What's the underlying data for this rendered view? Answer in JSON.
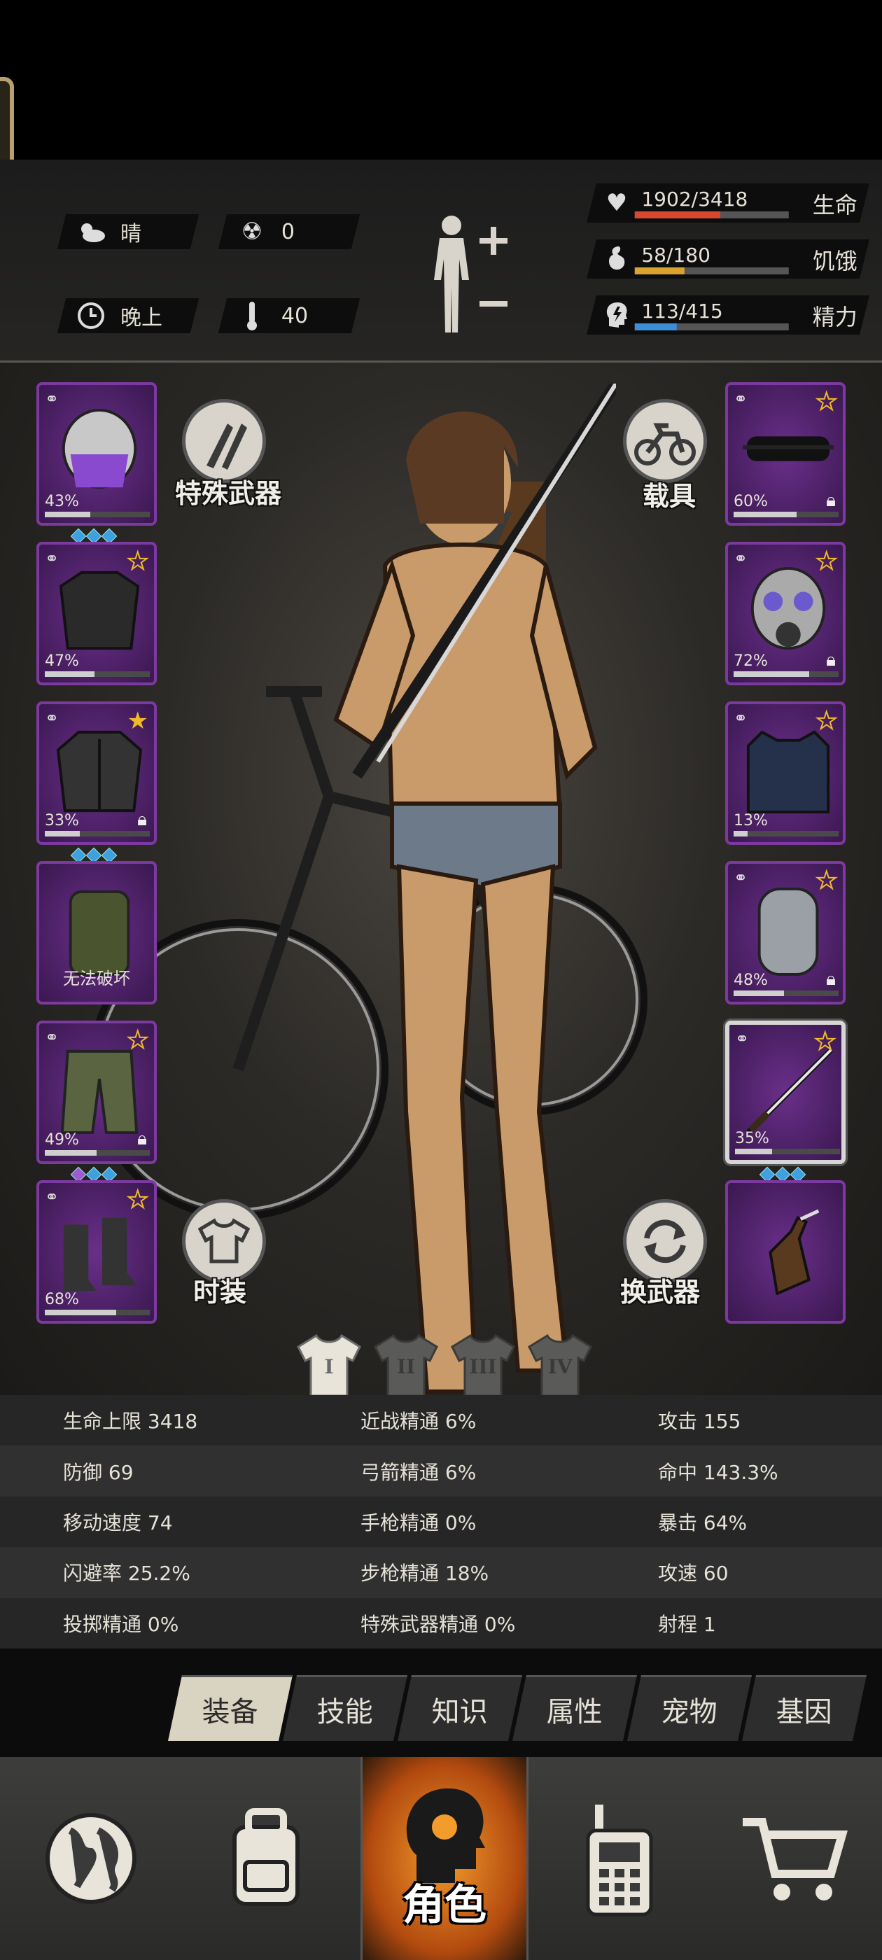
{
  "status": {
    "weather": {
      "icon": "cloud-sun-icon",
      "label": "晴"
    },
    "radiation": {
      "icon": "radiation-icon",
      "value": "0"
    },
    "time": {
      "icon": "clock-icon",
      "label": "晚上"
    },
    "temperature": {
      "icon": "thermometer-icon",
      "value": "40"
    },
    "vitals": [
      {
        "key": "life",
        "icon": "heart-icon",
        "value": "1902/3418",
        "label": "生命",
        "fill": 0.556,
        "color": "#d9482e"
      },
      {
        "key": "hunger",
        "icon": "stomach-icon",
        "value": "58/180",
        "label": "饥饿",
        "fill": 0.322,
        "color": "#d9a32e"
      },
      {
        "key": "energy",
        "icon": "head-bolt-icon",
        "value": "113/415",
        "label": "精力",
        "fill": 0.272,
        "color": "#3c8ed9"
      }
    ]
  },
  "slots_left": [
    {
      "name": "helmet",
      "icon": "police-helmet-icon",
      "pct": "43%",
      "durability": 0.43,
      "gems": 3
    },
    {
      "name": "shirt",
      "icon": "shirt-icon",
      "pct": "47%",
      "durability": 0.47,
      "star": "outline"
    },
    {
      "name": "jacket",
      "icon": "jacket-icon",
      "pct": "33%",
      "durability": 0.33,
      "star": "filled",
      "locked": true,
      "gems": 3
    },
    {
      "name": "backpack",
      "icon": "backpack-icon",
      "text": "无法破坏"
    },
    {
      "name": "pants",
      "icon": "camo-pants-icon",
      "pct": "49%",
      "durability": 0.49,
      "star": "outline",
      "locked": true,
      "gems": 3,
      "first_gem_purple": true
    },
    {
      "name": "boots",
      "icon": "boots-icon",
      "pct": "68%",
      "durability": 0.68,
      "star": "outline"
    }
  ],
  "slots_right": [
    {
      "name": "goggles",
      "icon": "goggles-icon",
      "pct": "60%",
      "durability": 0.6,
      "star": "outline",
      "locked": true
    },
    {
      "name": "gas-mask",
      "icon": "gas-mask-icon",
      "pct": "72%",
      "durability": 0.72,
      "star": "outline",
      "locked": true
    },
    {
      "name": "vest",
      "icon": "police-vest-icon",
      "pct": "13%",
      "durability": 0.13,
      "star": "outline"
    },
    {
      "name": "shield",
      "icon": "riot-shield-icon",
      "pct": "48%",
      "durability": 0.48,
      "star": "outline",
      "locked": true
    },
    {
      "name": "katana",
      "icon": "katana-icon",
      "pct": "35%",
      "durability": 0.35,
      "star": "outline",
      "gems": 3,
      "selected": true
    },
    {
      "name": "molotov",
      "icon": "molotov-icon"
    }
  ],
  "buttons": {
    "special_weapon": "特殊武器",
    "vehicle": "载具",
    "fashion": "时装",
    "swap_weapon": "换武器"
  },
  "outfits": [
    "I",
    "II",
    "III",
    "IV"
  ],
  "stats": [
    [
      "生命上限 3418",
      "近战精通 6%",
      "攻击 155"
    ],
    [
      "防御 69",
      "弓箭精通 6%",
      "命中 143.3%"
    ],
    [
      "移动速度 74",
      "手枪精通 0%",
      "暴击 64%"
    ],
    [
      "闪避率 25.2%",
      "步枪精通 18%",
      "攻速 60"
    ],
    [
      "投掷精通 0%",
      "特殊武器精通 0%",
      "射程 1"
    ]
  ],
  "tabs": [
    {
      "label": "装备",
      "active": true
    },
    {
      "label": "技能"
    },
    {
      "label": "知识"
    },
    {
      "label": "属性"
    },
    {
      "label": "宠物"
    },
    {
      "label": "基因"
    }
  ],
  "nav": [
    {
      "icon": "globe-icon"
    },
    {
      "icon": "backpack-icon"
    },
    {
      "icon": "head-icon",
      "label": "角色",
      "active": true
    },
    {
      "icon": "walkie-talkie-icon"
    },
    {
      "icon": "cart-icon"
    }
  ]
}
